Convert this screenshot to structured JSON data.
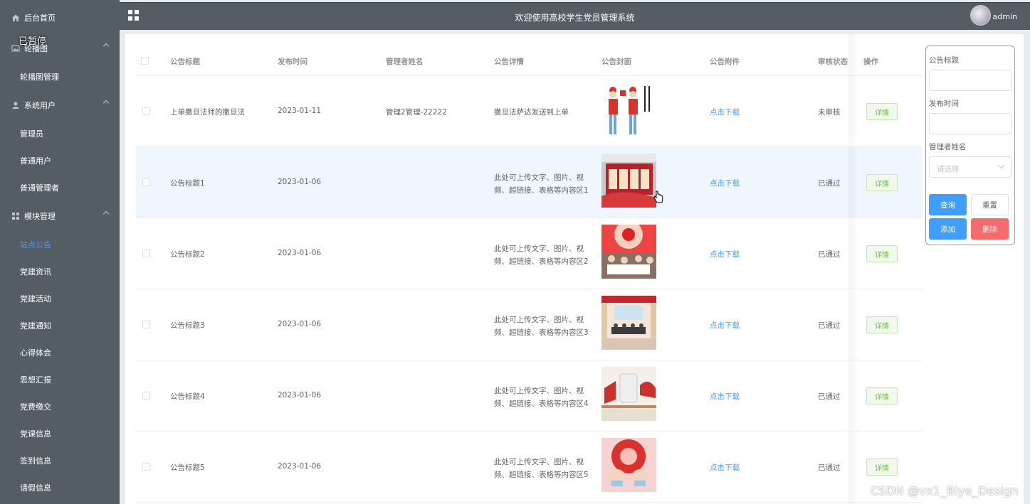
{
  "overlay": {
    "paused": "已暂停"
  },
  "sidebar": {
    "home": "后台首页",
    "groups": [
      {
        "label": "轮播图",
        "icon": "image-icon",
        "items": [
          "轮播图管理"
        ]
      },
      {
        "label": "系统用户",
        "icon": "user-icon",
        "items": [
          "管理员",
          "普通用户",
          "普通管理者"
        ]
      },
      {
        "label": "模块管理",
        "icon": "grid-icon",
        "items": [
          "站点公告",
          "党建资讯",
          "党建活动",
          "党建通知",
          "心得体会",
          "思想汇报",
          "党费缴交",
          "党课信息",
          "签到信息",
          "请假信息"
        ]
      }
    ],
    "active_item": "站点公告",
    "active_color": "#409eff"
  },
  "header": {
    "title": "欢迎使用高校学生党员管理系统",
    "user": "admin"
  },
  "table": {
    "columns": [
      "公告标题",
      "发布时间",
      "管理者姓名",
      "公告详情",
      "公告封面",
      "公告附件",
      "审核状态",
      "操作"
    ],
    "rows": [
      {
        "title": "上单撒旦法师的撒旦法",
        "date": "2023-01-11",
        "manager": "管理2管理-22222",
        "detail_lines": [
          "撒旦法萨达发送到上单"
        ],
        "attachment": "点击下载",
        "status": "未审核",
        "action": "详情"
      },
      {
        "title": "公告标题1",
        "date": "2023-01-06",
        "manager": "",
        "detail_lines": [
          "此处可上传文字、图片、视",
          "频、超链接、表格等内容区1"
        ],
        "attachment": "点击下载",
        "status": "已通过",
        "action": "详情"
      },
      {
        "title": "公告标题2",
        "date": "2023-01-06",
        "manager": "",
        "detail_lines": [
          "此处可上传文字、图片、视",
          "频、超链接、表格等内容区2"
        ],
        "attachment": "点击下载",
        "status": "已通过",
        "action": "详情"
      },
      {
        "title": "公告标题3",
        "date": "2023-01-06",
        "manager": "",
        "detail_lines": [
          "此处可上传文字、图片、视",
          "频、超链接、表格等内容区3"
        ],
        "attachment": "点击下载",
        "status": "已通过",
        "action": "详情"
      },
      {
        "title": "公告标题4",
        "date": "2023-01-06",
        "manager": "",
        "detail_lines": [
          "此处可上传文字、图片、视",
          "频、超链接、表格等内容区4"
        ],
        "attachment": "点击下载",
        "status": "已通过",
        "action": "详情"
      },
      {
        "title": "公告标题5",
        "date": "2023-01-06",
        "manager": "",
        "detail_lines": [
          "此处可上传文字、图片、视",
          "频、超链接、表格等内容区5"
        ],
        "attachment": "点击下载",
        "status": "已通过",
        "action": "详情"
      }
    ]
  },
  "filter": {
    "title_label": "公告标题",
    "date_label": "发布时间",
    "manager_label": "管理者姓名",
    "manager_placeholder": "请选择",
    "search": "查询",
    "reset": "重置",
    "add": "添加",
    "delete": "删除"
  },
  "watermark": "CSDN @vx1_Biye_Design"
}
